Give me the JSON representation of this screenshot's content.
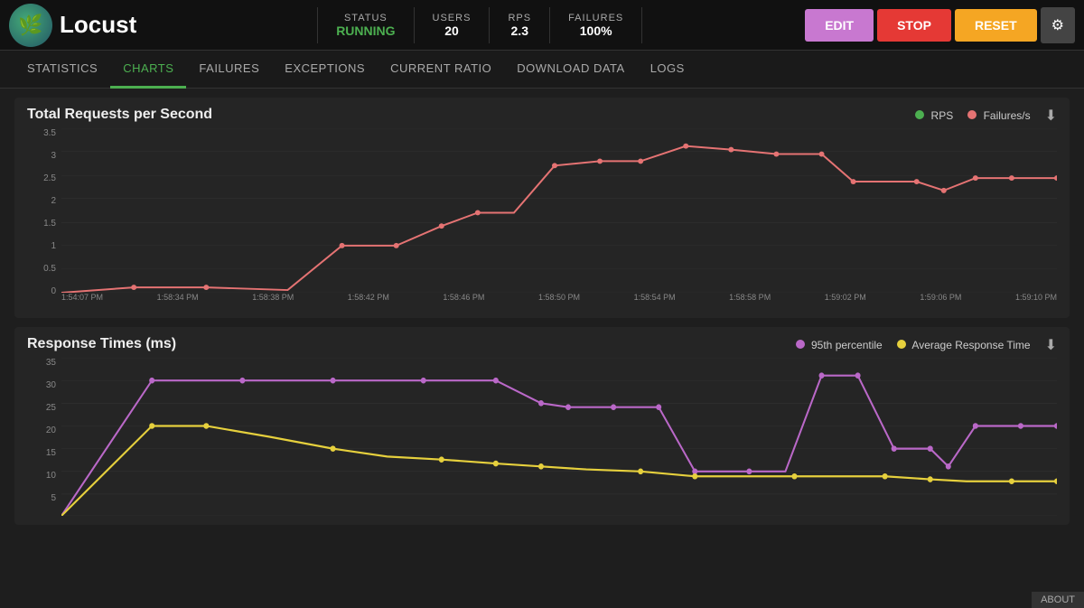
{
  "header": {
    "logo_text": "Locust",
    "status_label": "STATUS",
    "status_value": "RUNNING",
    "users_label": "USERS",
    "users_value": "20",
    "rps_label": "RPS",
    "rps_value": "2.3",
    "failures_label": "FAILURES",
    "failures_value": "100%",
    "edit_label": "EDIT",
    "stop_label": "STOP",
    "reset_label": "RESET"
  },
  "nav": {
    "items": [
      {
        "label": "STATISTICS",
        "active": false
      },
      {
        "label": "CHARTS",
        "active": true
      },
      {
        "label": "FAILURES",
        "active": false
      },
      {
        "label": "EXCEPTIONS",
        "active": false
      },
      {
        "label": "CURRENT RATIO",
        "active": false
      },
      {
        "label": "DOWNLOAD DATA",
        "active": false
      },
      {
        "label": "LOGS",
        "active": false
      }
    ]
  },
  "chart1": {
    "title": "Total Requests per Second",
    "legend": [
      {
        "label": "RPS",
        "color": "#4caf50"
      },
      {
        "label": "Failures/s",
        "color": "#e57373"
      }
    ],
    "y_labels": [
      "3.5",
      "3",
      "2.5",
      "2",
      "1.5",
      "1",
      "0.5",
      "0"
    ],
    "x_labels": [
      "1:54:07 PM",
      "1:58:34 PM",
      "1:58:38 PM",
      "1:58:42 PM",
      "1:58:46 PM",
      "1:58:50 PM",
      "1:58:54 PM",
      "1:58:58 PM",
      "1:59:02 PM",
      "1:59:06 PM",
      "1:59:10 PM"
    ]
  },
  "chart2": {
    "title": "Response Times (ms)",
    "legend": [
      {
        "label": "95th percentile",
        "color": "#ba68c8"
      },
      {
        "label": "Average Response Time",
        "color": "#e6d03d"
      }
    ],
    "y_labels": [
      "35",
      "30",
      "25",
      "20",
      "15",
      "10",
      "5"
    ],
    "x_labels": []
  },
  "about": "ABOUT"
}
